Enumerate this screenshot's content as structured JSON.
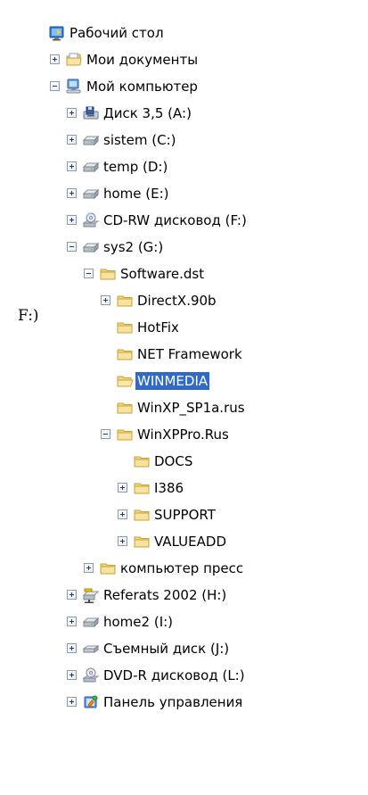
{
  "stray_text": "F:)",
  "tree": {
    "items": [
      {
        "label": "Рабочий стол",
        "icon": "desktop-icon",
        "depth": 0,
        "toggle": "none"
      },
      {
        "label": "Мои документы",
        "icon": "my-documents-icon",
        "depth": 1,
        "toggle": "plus"
      },
      {
        "label": "Мой компьютер",
        "icon": "my-computer-icon",
        "depth": 1,
        "toggle": "minus"
      },
      {
        "label": "Диск 3,5 (A:)",
        "icon": "floppy-drive-icon",
        "depth": 2,
        "toggle": "plus"
      },
      {
        "label": "sistem (C:)",
        "icon": "hard-drive-icon",
        "depth": 2,
        "toggle": "plus"
      },
      {
        "label": "temp (D:)",
        "icon": "hard-drive-icon",
        "depth": 2,
        "toggle": "plus"
      },
      {
        "label": "home (E:)",
        "icon": "hard-drive-icon",
        "depth": 2,
        "toggle": "plus"
      },
      {
        "label": "CD-RW дисковод (F:)",
        "icon": "cd-drive-icon",
        "depth": 2,
        "toggle": "plus"
      },
      {
        "label": "sys2 (G:)",
        "icon": "hard-drive-icon",
        "depth": 2,
        "toggle": "minus"
      },
      {
        "label": "Software.dst",
        "icon": "folder-icon",
        "depth": 3,
        "toggle": "minus"
      },
      {
        "label": "DirectX.90b",
        "icon": "folder-icon",
        "depth": 4,
        "toggle": "plus"
      },
      {
        "label": "HotFix",
        "icon": "folder-icon",
        "depth": 4,
        "toggle": "none"
      },
      {
        "label": "NET Framework",
        "icon": "folder-icon",
        "depth": 4,
        "toggle": "none"
      },
      {
        "label": "WINMEDIA",
        "icon": "folder-open-icon",
        "depth": 4,
        "toggle": "none",
        "selected": true
      },
      {
        "label": "WinXP_SP1a.rus",
        "icon": "folder-icon",
        "depth": 4,
        "toggle": "none"
      },
      {
        "label": "WinXPPro.Rus",
        "icon": "folder-icon",
        "depth": 4,
        "toggle": "minus"
      },
      {
        "label": "DOCS",
        "icon": "folder-icon",
        "depth": 5,
        "toggle": "none"
      },
      {
        "label": "I386",
        "icon": "folder-icon",
        "depth": 5,
        "toggle": "plus"
      },
      {
        "label": "SUPPORT",
        "icon": "folder-icon",
        "depth": 5,
        "toggle": "plus"
      },
      {
        "label": "VALUEADD",
        "icon": "folder-icon",
        "depth": 5,
        "toggle": "plus"
      },
      {
        "label": "компьютер пресс",
        "icon": "folder-icon",
        "depth": 3,
        "toggle": "plus"
      },
      {
        "label": "Referats 2002 (H:)",
        "icon": "network-drive-icon",
        "depth": 2,
        "toggle": "plus"
      },
      {
        "label": "home2 (I:)",
        "icon": "hard-drive-icon",
        "depth": 2,
        "toggle": "plus"
      },
      {
        "label": "Съемный диск (J:)",
        "icon": "removable-disk-icon",
        "depth": 2,
        "toggle": "plus"
      },
      {
        "label": "DVD-R дисковод (L:)",
        "icon": "dvd-drive-icon",
        "depth": 2,
        "toggle": "plus"
      },
      {
        "label": "Панель управления",
        "icon": "control-panel-icon",
        "depth": 2,
        "toggle": "plus"
      }
    ]
  },
  "colors": {
    "selection": "#316ac5",
    "selection_text": "#ffffff",
    "folder": "#f2d77a",
    "folder_edge": "#c9a23a"
  }
}
